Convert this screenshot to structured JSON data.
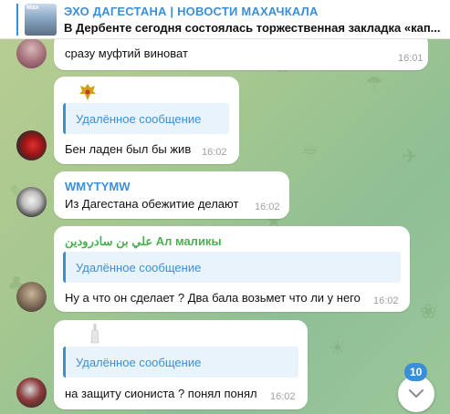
{
  "colors": {
    "accent": "#3a8fd9",
    "sender_green": "#4caf50",
    "reply_bg": "#e9f3fb",
    "time_gray": "#a0a0a0"
  },
  "header": {
    "thumb_text": "Мах",
    "title": "ЭХО ДАГЕСТАНА | НОВОСТИ МАХАЧКАЛА",
    "subtitle": "В Дербенте сегодня состоялась торжественная закладка «кап..."
  },
  "messages": [
    {
      "text": "сразу муфтий виноват",
      "time": "16:01"
    },
    {
      "reply": "Удалённое сообщение",
      "text": "Бен ладен был бы жив",
      "time": "16:02",
      "icon": "eagle-emblem-icon"
    },
    {
      "sender": "WMYTYMW",
      "text": "Из Дагестана обежитие делают",
      "time": "16:02"
    },
    {
      "sender": "علي بن سادرودين Ал маликы",
      "reply": "Удалённое сообщение",
      "text": "Ну а что он сделает ? Два бала возьмет что ли у него",
      "time": "16:02"
    },
    {
      "reply": "Удалённое сообщение",
      "text": "на защиту сиониста ? понял понял",
      "time": "16:02",
      "icon": "bottle-icon"
    }
  ],
  "scroll": {
    "unread_count": "10",
    "icon": "chevron-down-icon"
  }
}
